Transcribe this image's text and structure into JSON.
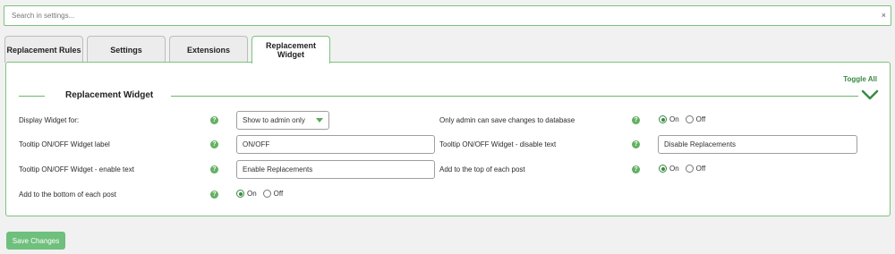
{
  "search": {
    "placeholder": "Search in settings...",
    "clear_glyph": "×"
  },
  "tabs": [
    {
      "label": "Replacement Rules"
    },
    {
      "label": "Settings"
    },
    {
      "label": "Extensions"
    },
    {
      "label": "Replacement Widget"
    }
  ],
  "panel": {
    "toggle_all": "Toggle All",
    "section_title": "Replacement Widget",
    "collapse_icon": "chevron-down-icon",
    "help_glyph": "?",
    "fields": {
      "display_widget_for": {
        "label": "Display Widget for:",
        "value": "Show to admin only"
      },
      "only_admin_save": {
        "label": "Only admin can save changes to database",
        "on_label": "On",
        "off_label": "Off",
        "selected": "On"
      },
      "tooltip_label": {
        "label": "Tooltip ON/OFF Widget label",
        "value": "ON/OFF"
      },
      "tooltip_disable_text": {
        "label": "Tooltip ON/OFF Widget - disable text",
        "value": "Disable Replacements"
      },
      "tooltip_enable_text": {
        "label": "Tooltip ON/OFF Widget - enable text",
        "value": "Enable Replacements"
      },
      "add_to_top": {
        "label": "Add to the top of each post",
        "on_label": "On",
        "off_label": "Off",
        "selected": "On"
      },
      "add_to_bottom": {
        "label": "Add to the bottom of each post",
        "on_label": "On",
        "off_label": "Off",
        "selected": "On"
      }
    }
  },
  "save_button": "Save Changes",
  "colors": {
    "accent": "#62b062",
    "border_accent": "#7dc27d",
    "save_button": "#6fbf7d"
  }
}
